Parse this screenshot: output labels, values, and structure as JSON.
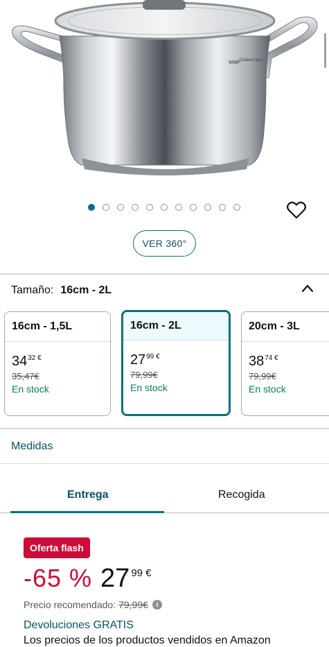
{
  "product_image": {
    "brand_logo_text": "WMF",
    "line_text": "Diadem plus",
    "icon": "stainless-pot-image"
  },
  "carousel": {
    "slide_count": 11,
    "active_index": 0,
    "wishlist_icon": "heart-icon"
  },
  "view360": {
    "label": "VER 360°"
  },
  "size_selector": {
    "label": "Tamaño:",
    "selected": "16cm - 2L",
    "toggle_icon": "chevron-up-icon",
    "options": [
      {
        "title": "16cm - 1,5L",
        "price_int": "34",
        "price_frac": "32 €",
        "old_price": "35,47€",
        "stock": "En stock",
        "selected": false
      },
      {
        "title": "16cm - 2L",
        "price_int": "27",
        "price_frac": "99 €",
        "old_price": "79,99€",
        "stock": "En stock",
        "selected": true
      },
      {
        "title": "20cm - 3L",
        "price_int": "38",
        "price_frac": "74 €",
        "old_price": "79,99€",
        "stock": "En stock",
        "selected": false
      }
    ]
  },
  "medidas_link": "Medidas",
  "tabs": [
    {
      "label": "Entrega",
      "active": true
    },
    {
      "label": "Recogida",
      "active": false
    }
  ],
  "deal": {
    "badge": "Oferta flash",
    "discount": "-65 %",
    "price_int": "27",
    "price_frac": "99 €",
    "recommended_label": "Precio recomendado:",
    "recommended_price": "79,99€",
    "info_icon": "info-icon",
    "returns": "Devoluciones GRATIS",
    "description": "Los precios de los productos vendidos en Amazon"
  },
  "colors": {
    "accent": "#007185",
    "link": "#0b4f6c",
    "deal_red": "#cc0c39",
    "stock_green": "#067d62"
  }
}
